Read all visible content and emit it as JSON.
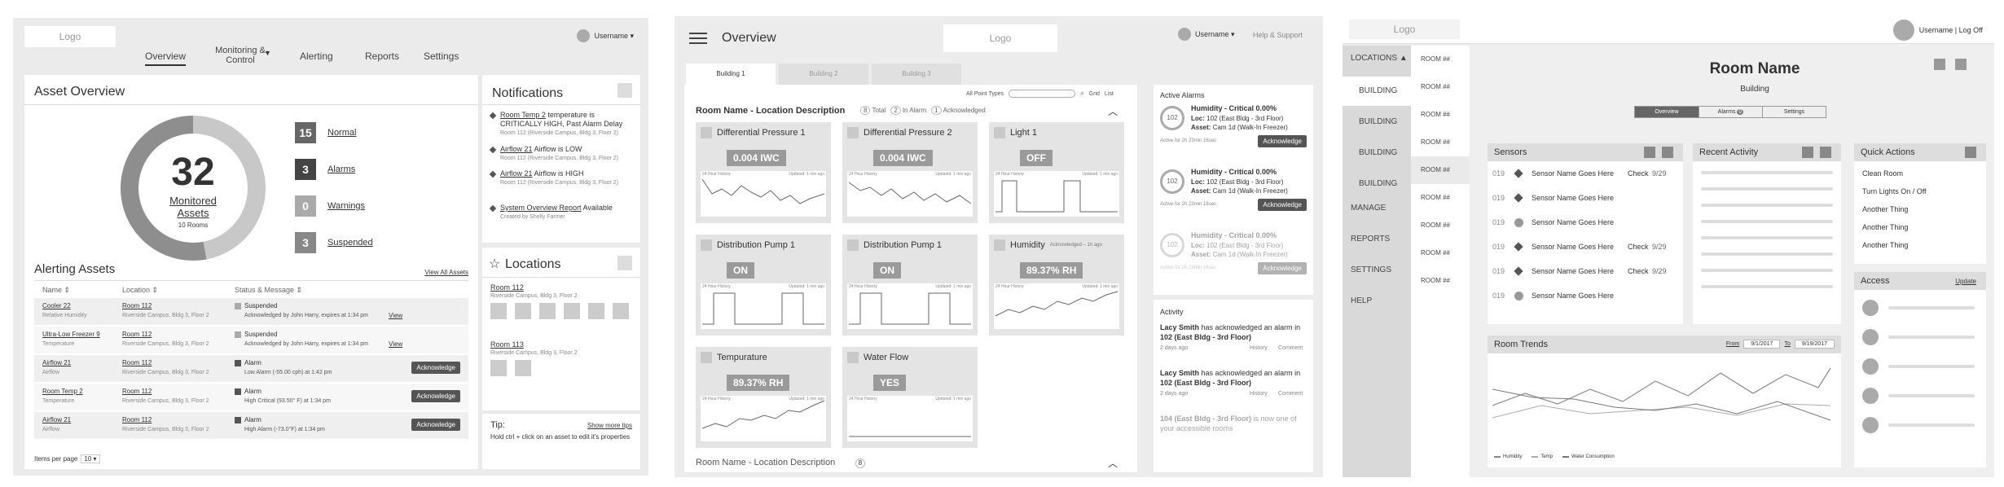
{
  "p1": {
    "logo": "Logo",
    "username": "Username ▾",
    "nav": [
      "Overview",
      "Monitoring & Control",
      "Alerting",
      "Reports",
      "Settings"
    ],
    "nav_active": "Overview",
    "asset_overview_title": "Asset Overview",
    "donut": {
      "value": "32",
      "label_line1": "Monitored",
      "label_line2": "Assets",
      "sub": "10 Rooms",
      "normal_fraction": 0.47
    },
    "stats": [
      {
        "count": "15",
        "label": "Normal"
      },
      {
        "count": "3",
        "label": "Alarms"
      },
      {
        "count": "0",
        "label": "Warnings"
      },
      {
        "count": "3",
        "label": "Suspended"
      }
    ],
    "alerting_title": "Alerting Assets",
    "view_all": "View All Assets",
    "cols": [
      "Name ⇕",
      "Location ⇕",
      "Status & Message ⇕"
    ],
    "rows": [
      {
        "name": "Cooler 22",
        "type": "Relative Humidity",
        "loc": "Room 112",
        "loc2": "Riverside Campus, Bldg 3, Floor 2",
        "status": "Suspended",
        "msg": "Acknowledged by John Harry, expires at 1:34 pm",
        "action": "View"
      },
      {
        "name": "Ultra-Low Freezer 9",
        "type": "Temperature",
        "loc": "Room 112",
        "loc2": "Riverside Campus, Bldg 3, Floor 2",
        "status": "Suspended",
        "msg": "Acknowledged by John Harry, expires at 1:34 pm",
        "action": "View"
      },
      {
        "name": "Airflow 21",
        "type": "Airflow",
        "loc": "Room 112",
        "loc2": "Riverside Campus, Bldg 3, Floor 2",
        "status": "Alarm",
        "msg": "Low Alarm (-55.00 cph) at 1:42 pm",
        "action": "Acknowledge"
      },
      {
        "name": "Room Temp 2",
        "type": "Temperature",
        "loc": "Room 112",
        "loc2": "Riverside Campus, Bldg 3, Floor 2",
        "status": "Alarm",
        "msg": "High Critical (93.50° F) at 1:34 pm",
        "action": "Acknowledge"
      },
      {
        "name": "Airflow 21",
        "type": "Airflow",
        "loc": "Room 112",
        "loc2": "Riverside Campus, Bldg 3, Floor 2",
        "status": "Alarm",
        "msg": "High Alarm (-73.0°F) at 1:34 pm",
        "action": "Acknowledge"
      }
    ],
    "items_per_page": "Items per page",
    "items_per_page_val": "10 ▾",
    "notifications_title": "Notifications",
    "notifications": [
      {
        "link": "Room Temp 2",
        "text": " temperature is CRITICALLY HIGH, Past Alarm Delay",
        "sub": "Room 112 (Riverside Campus, Bldg 3, Floor 2)"
      },
      {
        "link": "Airflow 21",
        "text": " Airflow is LOW",
        "sub": "Room 112 (Riverside Campus, Bldg 3, Floor 2)"
      },
      {
        "link": "Airflow 21",
        "text": " Airflow is HIGH",
        "sub": "Room 112 (Riverside Campus, Bldg 3, Floor 2)"
      },
      {
        "link": "System Overview Report",
        "text": " Available",
        "sub": "Created by Shelly Farmer"
      }
    ],
    "locations_title": "Locations",
    "locations": [
      {
        "name": "Room 112",
        "sub": "Riverside Campus, Bldg 3, Floor 2",
        "thumbs": 6
      },
      {
        "name": "Room 113",
        "sub": "Riverside Campus, Bldg 3, Floor 2",
        "thumbs": 2
      }
    ],
    "tip_title": "Tip:",
    "tip_link": "Show more tips",
    "tip_text": "Hold ctrl + click on an asset to edit it's properties"
  },
  "p2": {
    "title": "Overview",
    "logo": "Logo",
    "username": "Username ▾",
    "help": "Help & Support",
    "tabs": [
      "Building 1",
      "Building 2",
      "Building 3"
    ],
    "filter_label": "All Point Types",
    "view_grid": "Grid",
    "view_list": "List",
    "room_title": "Room Name - Location Description",
    "counts": [
      {
        "n": "8",
        "label": "Total"
      },
      {
        "n": "2",
        "label": "In Alarm"
      },
      {
        "n": "1",
        "label": "Acknowledged"
      }
    ],
    "tiles": [
      {
        "name": "Differential Pressure 1",
        "value": "0.004 IWC",
        "hist": "24 Hour History",
        "upd": "Updated: 1 min ago",
        "ack": ""
      },
      {
        "name": "Differential Pressure 2",
        "value": "0.004 IWC",
        "hist": "24 Hour History",
        "upd": "Updated: 1 min ago",
        "ack": ""
      },
      {
        "name": "Light 1",
        "value": "OFF",
        "hist": "24 Hour History",
        "upd": "Updated: 1 min ago",
        "ack": ""
      },
      {
        "name": "Distribution Pump 1",
        "value": "ON",
        "hist": "24 Hour History",
        "upd": "Updated: 1 min ago",
        "ack": ""
      },
      {
        "name": "Distribution Pump 1",
        "value": "ON",
        "hist": "24 Hour History",
        "upd": "Updated: 1 min ago",
        "ack": ""
      },
      {
        "name": "Humidity",
        "value": "89.37% RH",
        "hist": "24 Hour History",
        "upd": "Updated: 1 min ago",
        "ack": "Acknowledged – 1h ago"
      },
      {
        "name": "Tempurature",
        "value": "89.37% RH",
        "hist": "24 Hour History",
        "upd": "Updated: 1 min ago",
        "ack": ""
      },
      {
        "name": "Water Flow",
        "value": "YES",
        "hist": "24 Hour History",
        "upd": "Updated: 1 min ago",
        "ack": ""
      }
    ],
    "room_title2": "Room Name - Location Description",
    "room_count2": "8",
    "active_alarms_title": "Active Alarms",
    "alarms": [
      {
        "badge": "102",
        "title": "Humidity - Critical 0.00%",
        "loc_label": "Loc:",
        "loc": " 102 (East Bldg - 3rd Floor)",
        "asset_label": "Asset:",
        "asset": " Cam 1d (Walk-In Freezer)",
        "time": "Active for 2h 23min 16sec",
        "action": "Acknowledge"
      },
      {
        "badge": "102",
        "title": "Humidity - Critical 0.00%",
        "loc_label": "Loc:",
        "loc": " 102 (East Bldg - 3rd Floor)",
        "asset_label": "Asset:",
        "asset": " Cam 1d (Walk-In Freezer)",
        "time": "Active for 2h 23min 16sec",
        "action": "Acknowledge"
      },
      {
        "badge": "102",
        "title": "Humidity - Critical 0.00%",
        "loc_label": "Loc:",
        "loc": " 102 (East Bldg - 3rd Floor)",
        "asset_label": "Asset:",
        "asset": " Cam 1d (Walk-In Freezer)",
        "time": "Active for 2h 23min 16sec",
        "action": "Acknowledge"
      }
    ],
    "activity_title": "Activity",
    "activity": [
      {
        "who": "Lacy Smith",
        "text": " has acknowledged an alarm in ",
        "where": "102 (East Bldg - 3rd Floor)",
        "time": "2 days ago",
        "l1": "History",
        "l2": "Comment"
      },
      {
        "who": "Lacy Smith",
        "text": " has acknowledged an alarm in ",
        "where": "102 (East Bldg - 3rd Floor)",
        "time": "2 days ago",
        "l1": "History",
        "l2": "Comment"
      },
      {
        "who": "104 (East Bldg - 3rd Floor)",
        "text": " is now one of your accessible rooms",
        "where": "",
        "time": "",
        "l1": "",
        "l2": ""
      }
    ]
  },
  "p3": {
    "logo": "Logo",
    "username": "Username | Log Off",
    "locations": "LOCATIONS ▲",
    "buildings": [
      "BUILDING",
      "BUILDING",
      "BUILDING",
      "BUILDING"
    ],
    "menu": [
      "MANAGE",
      "REPORTS",
      "SETTINGS",
      "HELP"
    ],
    "rooms": [
      "ROOM ##",
      "ROOM ##",
      "ROOM ##",
      "ROOM ##",
      "ROOM ##",
      "ROOM ##",
      "ROOM ##",
      "ROOM ##",
      "ROOM ##"
    ],
    "room_name": "Room Name",
    "building": "Building",
    "seg": [
      "Overview",
      "Alarms",
      "Settings"
    ],
    "alarm_badge": "0",
    "sensors_title": "Sensors",
    "sensors": [
      {
        "id": "019",
        "icon": "diamond",
        "name": "Sensor Name Goes Here",
        "check": "Check",
        "date": "9/29"
      },
      {
        "id": "019",
        "icon": "diamond",
        "name": "Sensor Name Goes Here",
        "check": "",
        "date": ""
      },
      {
        "id": "019",
        "icon": "check",
        "name": "Sensor Name Goes Here",
        "check": "",
        "date": ""
      },
      {
        "id": "019",
        "icon": "diamond",
        "name": "Sensor Name Goes Here",
        "check": "Check",
        "date": "9/29"
      },
      {
        "id": "019",
        "icon": "diamond",
        "name": "Sensor Name Goes Here",
        "check": "Check",
        "date": "9/29"
      },
      {
        "id": "019",
        "icon": "check",
        "name": "Sensor Name Goes Here",
        "check": "",
        "date": ""
      }
    ],
    "recent_title": "Recent Activity",
    "quick_title": "Quick Actions",
    "quick": [
      "Clean Room",
      "Turn Lights On / Off",
      "Another Thing",
      "Another Thing",
      "Another Thing"
    ],
    "access_title": "Access",
    "access_link": "Update",
    "trends_title": "Room Trends",
    "from_label": "From",
    "from_val": "9/1/2017",
    "to_label": "To",
    "to_val": "9/19/2017",
    "legend": [
      "Humidity",
      "Temp",
      "Water Consumption"
    ]
  }
}
